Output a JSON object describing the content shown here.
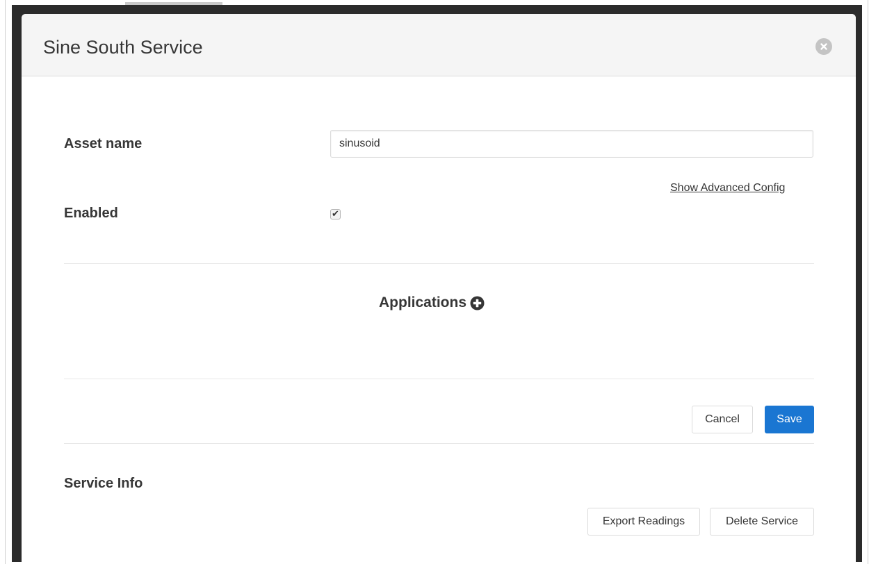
{
  "modal": {
    "title": "Sine South Service"
  },
  "form": {
    "asset_name_label": "Asset name",
    "asset_name_value": "sinusoid",
    "enabled_label": "Enabled",
    "enabled_checked": true,
    "advanced_link": "Show Advanced Config"
  },
  "applications": {
    "label": "Applications"
  },
  "actions": {
    "cancel_label": "Cancel",
    "save_label": "Save"
  },
  "service_info": {
    "heading": "Service Info",
    "export_label": "Export Readings",
    "delete_label": "Delete Service"
  },
  "colors": {
    "primary": "#1a76d2",
    "header_bg": "#f5f5f5",
    "text": "#363636",
    "close_icon_bg": "#c4c4c4"
  },
  "icons": {
    "close": "close-icon",
    "add_application": "plus-circle-icon",
    "checkbox": "checkmark-icon"
  }
}
